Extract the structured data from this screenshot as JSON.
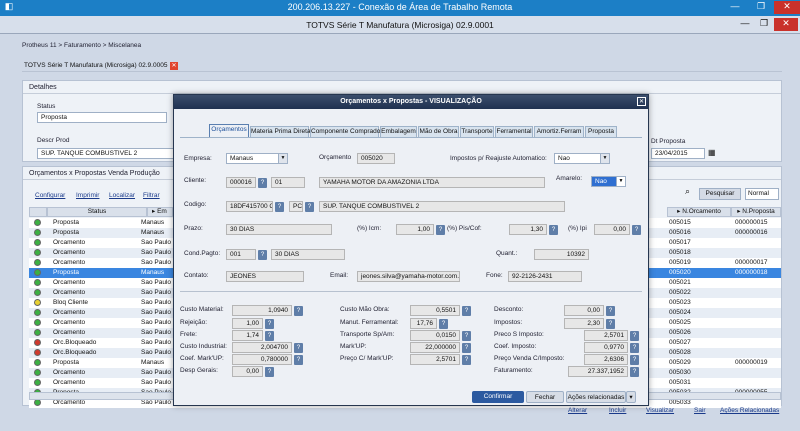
{
  "rdp": {
    "title": "200.206.13.227 - Conexão de Área de Trabalho Remota"
  },
  "app": {
    "title": "TOTVS Série T Manufatura (Microsiga) 02.9.0001"
  },
  "breadcrumb": "Protheus 11 > Faturamento > Miscelanea",
  "doc_tab": "TOTVS Série T Manufatura (Microsiga) 02.9.0005",
  "details": {
    "header": "Detalhes",
    "status_label": "Status",
    "status_value": "Proposta",
    "descr_label": "Descr Prod",
    "descr_value": "SUP. TANQUE COMBUSTIVEL 2",
    "dt_label": "Dt Proposta",
    "dt_value": "23/04/2015"
  },
  "grid": {
    "header": "Orçamentos x Propostas Venda Produção",
    "actions": [
      "Configurar",
      "Imprimir",
      "Localizar",
      "Filtrar"
    ],
    "search_btn": "Pesquisar",
    "normal_select": "Normal",
    "col_status": "Status",
    "col_e": "Em",
    "col_orc": "N.Orcamento",
    "col_prop": "N.Proposta",
    "rows": [
      {
        "color": "#3cb043",
        "status": "Proposta",
        "em": "Manaus",
        "orc": "005015",
        "prop": "000000015"
      },
      {
        "color": "#3cb043",
        "status": "Proposta",
        "em": "Manaus",
        "orc": "005016",
        "prop": "000000016"
      },
      {
        "color": "#3cb043",
        "status": "Orcamento",
        "em": "Sao Paulo",
        "orc": "005017",
        "prop": ""
      },
      {
        "color": "#3cb043",
        "status": "Orcamento",
        "em": "Sao Paulo",
        "orc": "005018",
        "prop": ""
      },
      {
        "color": "#3cb043",
        "status": "Orcamento",
        "em": "Sao Paulo",
        "orc": "005019",
        "prop": "000000017"
      },
      {
        "color": "#3cb043",
        "status": "Proposta",
        "em": "Manaus",
        "orc": "005020",
        "prop": "000000018",
        "selected": true
      },
      {
        "color": "#3cb043",
        "status": "Orcamento",
        "em": "Sao Paulo",
        "orc": "005021",
        "prop": ""
      },
      {
        "color": "#3cb043",
        "status": "Orcamento",
        "em": "Sao Paulo",
        "orc": "005022",
        "prop": ""
      },
      {
        "color": "#e8d030",
        "status": "Bloq Cliente",
        "em": "Sao Paulo",
        "orc": "005023",
        "prop": ""
      },
      {
        "color": "#3cb043",
        "status": "Orcamento",
        "em": "Sao Paulo",
        "orc": "005024",
        "prop": ""
      },
      {
        "color": "#3cb043",
        "status": "Orcamento",
        "em": "Sao Paulo",
        "orc": "005025",
        "prop": ""
      },
      {
        "color": "#3cb043",
        "status": "Orcamento",
        "em": "Sao Paulo",
        "orc": "005026",
        "prop": ""
      },
      {
        "color": "#d03a2e",
        "status": "Orc.Bloqueado",
        "em": "Sao Paulo",
        "orc": "005027",
        "prop": ""
      },
      {
        "color": "#d03a2e",
        "status": "Orc.Bloqueado",
        "em": "Sao Paulo",
        "orc": "005028",
        "prop": ""
      },
      {
        "color": "#3cb043",
        "status": "Proposta",
        "em": "Manaus",
        "orc": "005029",
        "prop": "000000019"
      },
      {
        "color": "#3cb043",
        "status": "Orcamento",
        "em": "Sao Paulo",
        "orc": "005030",
        "prop": ""
      },
      {
        "color": "#3cb043",
        "status": "Orcamento",
        "em": "Sao Paulo",
        "orc": "005031",
        "prop": ""
      },
      {
        "color": "#3cb043",
        "status": "Proposta",
        "em": "Sao Paulo",
        "orc": "005032",
        "prop": "000000055"
      },
      {
        "color": "#3cb043",
        "status": "Orcamento",
        "em": "Sao Paulo",
        "orc": "005033",
        "prop": ""
      }
    ]
  },
  "bottom_actions": [
    "Alterar",
    "Incluir",
    "Visualizar",
    "Sair",
    "Ações Relacionadas"
  ],
  "modal": {
    "title": "Orçamentos x Propostas - VISUALIZAÇÃO",
    "tabs": [
      "Orçamentos",
      "Materia Prima Direta",
      "Componente Comprado",
      "Embalagem",
      "Mão de Obra",
      "Transporte",
      "Ferramental",
      "Amortiz.Ferram",
      "Proposta"
    ],
    "empresa_label": "Empresa:",
    "empresa_value": "Manaus",
    "orcamento_label": "Orçamento",
    "orcamento_value": "005020",
    "impostos_label": "Impostos p/ Reajuste Automatico:",
    "impostos_value": "Nao",
    "cliente_label": "Cliente:",
    "cliente_code": "000016",
    "cliente_loja": "01",
    "cliente_nome": "YAMAHA MOTOR DA AMAZONIA LTDA",
    "amarelo_label": "Amarelo:",
    "amarelo_value": "Nao",
    "codigo_label": "Codigo:",
    "codigo_value": "18DF415700  CO",
    "codigo_um": "PC",
    "codigo_desc": "SUP. TANQUE COMBUSTIVEL 2",
    "prazo_label": "Prazo:",
    "prazo_value": "30 DIAS",
    "icm_label": "(%) Icm:",
    "icm_value": "1,00",
    "pis_label": "(%) Pis/Cof:",
    "pis_value": "1,30",
    "ipi_label": "(%) Ipi",
    "ipi_value": "0,00",
    "cond_label": "Cond.Pagto:",
    "cond_code": "001",
    "cond_desc": "30 DIAS",
    "quant_label": "Quant.:",
    "quant_value": "10392",
    "contato_label": "Contato:",
    "contato_value": "JEONES",
    "email_label": "Email:",
    "email_value": "jeones.silva@yamaha-motor.com.br",
    "fone_label": "Fone:",
    "fone_value": "92-2126-2431",
    "custo_mat_label": "Custo Material:",
    "custo_mat_value": "1,0940",
    "rejeicao_label": "Rejeição:",
    "rejeicao_value": "1,00",
    "frete_label": "Frete:",
    "frete_value": "1,74",
    "custo_ind_label": "Custo Industrial:",
    "custo_ind_value": "2,004700",
    "coef_mark_label": "Coef. Mark'UP:",
    "coef_mark_value": "0,780000",
    "desp_label": "Desp Gerais:",
    "desp_value": "0,00",
    "custo_mo_label": "Custo Mão Obra:",
    "custo_mo_value": "0,5501",
    "manut_label": "Manut. Ferramental:",
    "manut_value": "17,76",
    "transp_label": "Transporte Sp/Am:",
    "transp_value": "0,0150",
    "markup_label": "Mark'UP:",
    "markup_value": "22,000000",
    "preco_mark_label": "Preço C/ Mark'UP:",
    "preco_mark_value": "2,5701",
    "desconto_label": "Desconto:",
    "desconto_value": "0,00",
    "impostos2_label": "Impostos:",
    "impostos2_value": "2,30",
    "preco_s_label": "Preco S Imposto:",
    "preco_s_value": "2,5701",
    "coef_imp_label": "Coef. Imposto:",
    "coef_imp_value": "0,9770",
    "preco_venda_label": "Preço Venda C/Imposto:",
    "preco_venda_value": "2,6306",
    "faturamento_label": "Faturamento:",
    "faturamento_value": "27.337,1952",
    "confirmar": "Confirmar",
    "fechar": "Fechar",
    "acoes": "Ações relacionadas"
  }
}
